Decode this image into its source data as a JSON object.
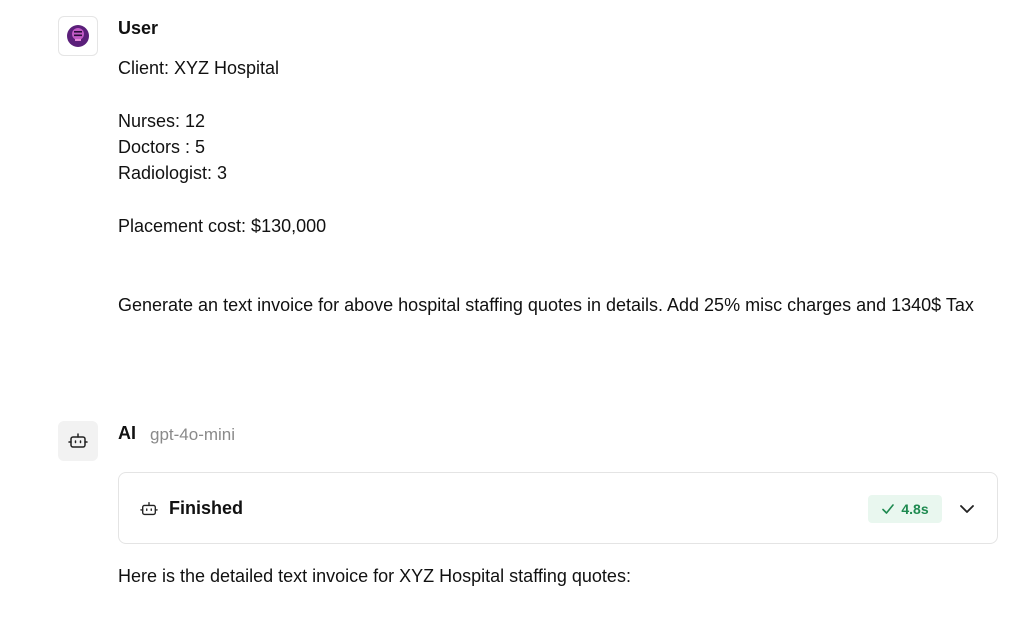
{
  "user": {
    "name": "User",
    "message": {
      "client": "Client: XYZ Hospital",
      "nurses": "Nurses: 12",
      "doctors": "Doctors : 5",
      "radiologist": "Radiologist: 3",
      "placement_cost": "Placement cost: $130,000",
      "request": "Generate an text invoice for above hospital staffing quotes in details. Add 25% misc charges and 1340$ Tax"
    }
  },
  "ai": {
    "name": "AI",
    "model": "gpt-4o-mini",
    "status": {
      "label": "Finished",
      "duration": "4.8s"
    },
    "message": "Here is the detailed text invoice for XYZ Hospital staffing quotes:"
  },
  "icons": {
    "user_avatar": "user-avatar-icon",
    "ai_avatar": "robot-icon",
    "status": "robot-icon",
    "badge": "check-icon",
    "expand": "chevron-down-icon"
  },
  "colors": {
    "badge_bg": "#e9f7ef",
    "badge_text": "#1e8a50",
    "avatar_purple": "#5b1f7a"
  }
}
